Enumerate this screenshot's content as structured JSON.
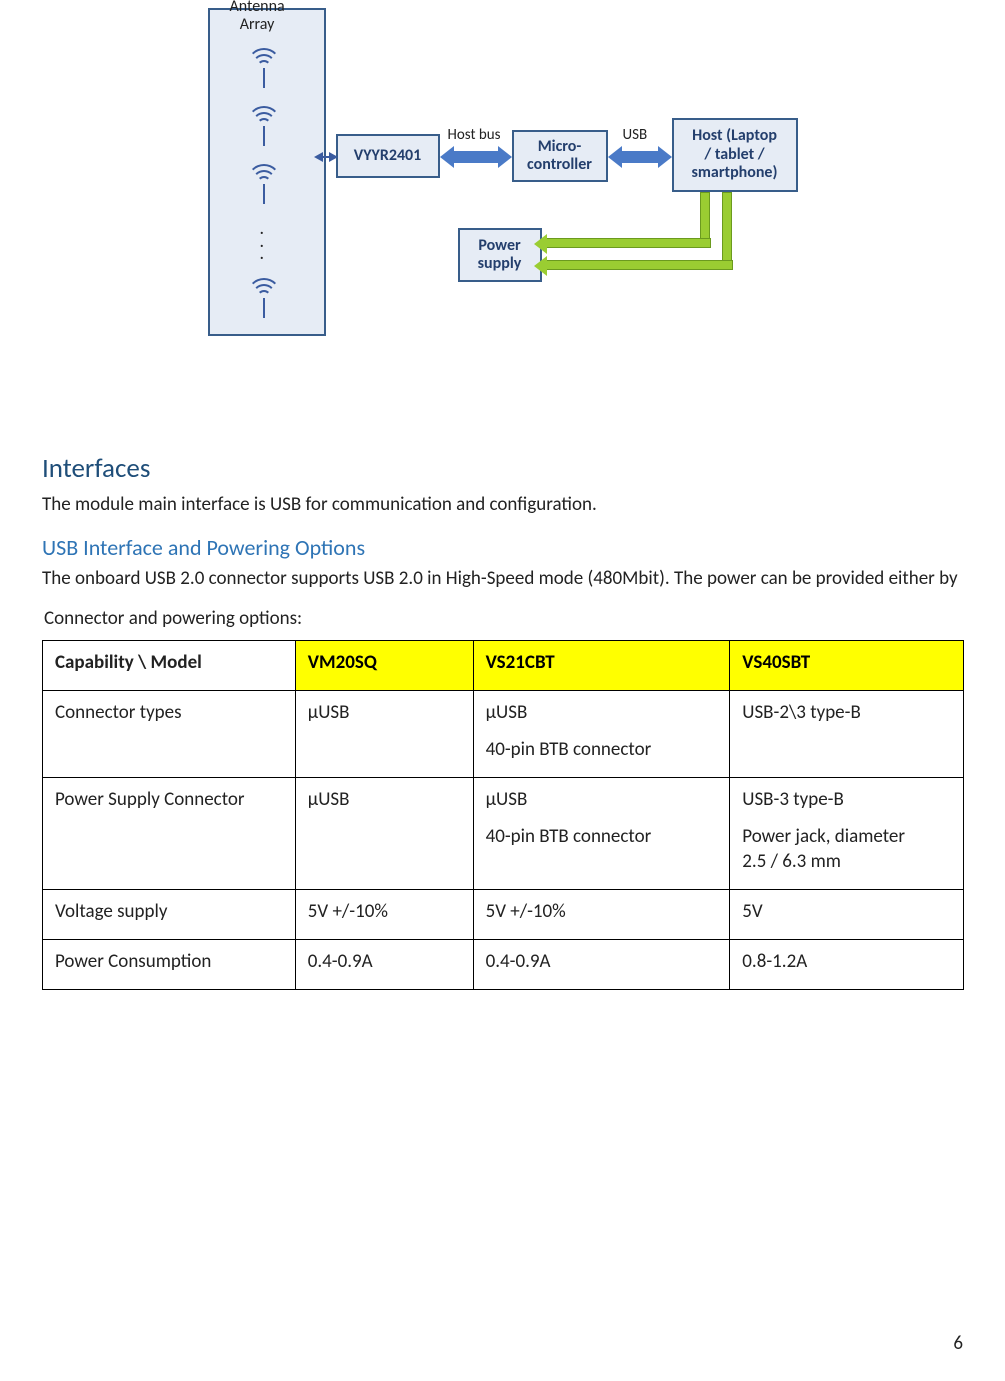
{
  "diagram": {
    "antenna_array_label": "Antenna\nArray",
    "vyyr_box": "VYYR2401",
    "micro_box": "Micro-\ncontroller",
    "host_box": "Host (Laptop\n/ tablet /\nsmartphone)",
    "power_box": "Power\nsupply",
    "host_bus_label": "Host bus",
    "usb_label": "USB"
  },
  "sections": {
    "interfaces_title": "Interfaces",
    "interfaces_body": "The module main interface is USB for communication and configuration.",
    "usb_title": "USB Interface and Powering Options",
    "usb_body": "The onboard USB 2.0 connector supports USB 2.0 in High-Speed mode (480Mbit). The power can be provided either by",
    "table_caption": "Connector and powering options:"
  },
  "table": {
    "header": {
      "capability": "Capability   \\   Model",
      "c1": "VM20SQ",
      "c2": "VS21CBT",
      "c3": "VS40SBT"
    },
    "rows": [
      {
        "label": "Connector types",
        "c1": "μUSB",
        "c2a": "μUSB",
        "c2b": "40-pin BTB connector",
        "c3a": "USB-2\\3 type-B",
        "c3b": ""
      },
      {
        "label": "Power Supply Connector",
        "c1": "μUSB",
        "c2a": "μUSB",
        "c2b": "40-pin BTB connector",
        "c3a": "USB-3 type-B",
        "c3b": "Power jack, diameter",
        "c3c": "2.5 / 6.3 mm"
      },
      {
        "label": "Voltage supply",
        "c1": "5V +/-10%",
        "c2a": "5V +/-10%",
        "c2b": "",
        "c3a": "5V",
        "c3b": ""
      },
      {
        "label": "Power Consumption",
        "c1": "0.4-0.9A",
        "c2a": "0.4-0.9A",
        "c2b": "",
        "c3a": "0.8-1.2A",
        "c3b": ""
      }
    ]
  },
  "page_number": "6"
}
